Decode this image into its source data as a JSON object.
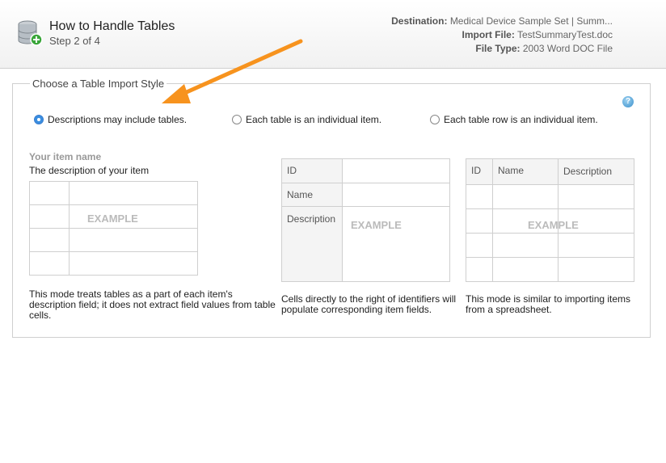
{
  "header": {
    "title": "How to Handle Tables",
    "step": "Step 2 of 4",
    "destination_label": "Destination:",
    "destination_value": "Medical Device Sample Set | Summ...",
    "import_file_label": "Import File:",
    "import_file_value": "TestSummaryTest.doc",
    "file_type_label": "File Type:",
    "file_type_value": "2003 Word DOC File"
  },
  "panel": {
    "legend": "Choose a Table Import Style",
    "help": "?"
  },
  "options": [
    {
      "label": "Descriptions may include tables.",
      "selected": true
    },
    {
      "label": "Each table is an individual item.",
      "selected": false
    },
    {
      "label": "Each table row is an individual item.",
      "selected": false
    }
  ],
  "example1": {
    "item_name": "Your item name",
    "item_desc": "The description of your item",
    "watermark": "EXAMPLE",
    "description": "This mode treats tables as a part of each item's description field; it does not extract field values from table cells."
  },
  "example2": {
    "rows": [
      "ID",
      "Name",
      "Description"
    ],
    "watermark": "EXAMPLE",
    "description": "Cells directly to the right of identifiers will populate corresponding item fields."
  },
  "example3": {
    "headers": [
      "ID",
      "Name",
      "Description"
    ],
    "watermark": "EXAMPLE",
    "description": "This mode is similar to importing items from a spreadsheet."
  },
  "colors": {
    "arrow": "#f7931e",
    "radio_selected": "#3a8ee0",
    "border": "#cfcfcf"
  }
}
